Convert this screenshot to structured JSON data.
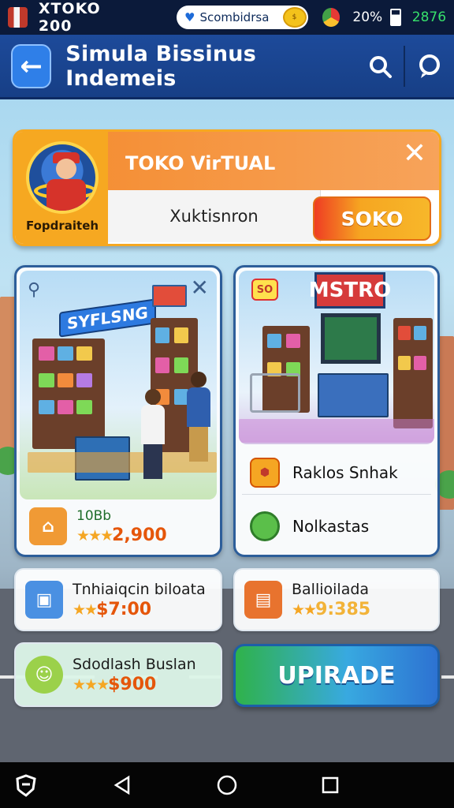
{
  "status_bar": {
    "carrier": "XTOKO 200",
    "pill_text": "Scombidrsa",
    "battery_text": "20%",
    "time": "2876"
  },
  "app_bar": {
    "title": "Simula Bissinus Indemeis",
    "icons": [
      "back-arrow-icon",
      "search-icon",
      "chat-icon"
    ]
  },
  "store_banner": {
    "avatar_label": "Fopdraiteh",
    "title": "TOKO VirTUAL",
    "subtitle": "Xuktisnron",
    "button_label": "SOKO",
    "close_icon": "close-icon"
  },
  "left_panel": {
    "sign_text": "SYFLSNG",
    "featured": {
      "name": "10Bb",
      "price": "2,900",
      "stars": "★★★"
    }
  },
  "left_items": [
    {
      "name": "Tnhiaiqcin biloata",
      "price": "$7:00",
      "stars": "★★"
    },
    {
      "name": "Sdodlash Buslan",
      "price": "$900",
      "stars": "★★★"
    }
  ],
  "right_panel": {
    "sign_text": "MSTRO",
    "badge_text": "SO",
    "items": [
      {
        "label": "Raklos Snhak",
        "icon": "tag-icon"
      },
      {
        "label": "Nolkastas",
        "icon": "badge-icon"
      }
    ]
  },
  "right_item_card": {
    "name": "Ballioilada",
    "price": "9:385",
    "stars": "★★"
  },
  "upgrade_button": {
    "label": "UPIRADE"
  },
  "nav_bar": {
    "icons": [
      "shield-icon",
      "back-nav-icon",
      "home-nav-icon",
      "recents-nav-icon"
    ]
  },
  "colors": {
    "app_bar": "#1d4a9a",
    "banner_header": "#f48a2c",
    "store_button": "#f6a621",
    "price_text": "#e5560a",
    "upgrade_green": "#2fb24a",
    "upgrade_blue": "#2d72d2"
  }
}
